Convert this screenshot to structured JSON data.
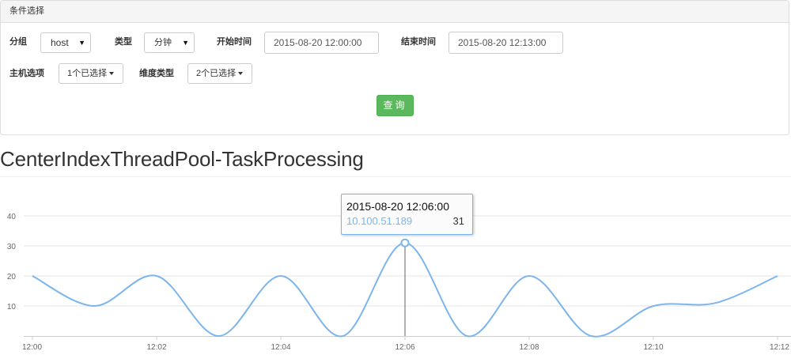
{
  "filter_panel": {
    "title": "条件选择",
    "group_label": "分组",
    "group_value": "host",
    "type_label": "类型",
    "type_value": "分钟",
    "start_label": "开始时间",
    "start_value": "2015-08-20 12:00:00",
    "end_label": "结束时间",
    "end_value": "2015-08-20 12:13:00",
    "host_label": "主机选项",
    "host_value": "1个已选择",
    "dim_label": "维度类型",
    "dim_value": "2个已选择",
    "query_button": "查询"
  },
  "chart_title": "CenterIndexThreadPool-TaskProcessing",
  "tooltip": {
    "time": "2015-08-20 12:06:00",
    "series": "10.100.51.189",
    "value": "31"
  },
  "colors": {
    "series": "#7cb5ec",
    "query_button": "#5cb85c",
    "grid": "#e6e6e6"
  },
  "chart_data": {
    "type": "line",
    "title": "CenterIndexThreadPool-TaskProcessing",
    "x": [
      "12:00",
      "12:01",
      "12:02",
      "12:03",
      "12:04",
      "12:05",
      "12:06",
      "12:07",
      "12:08",
      "12:09",
      "12:10",
      "12:11",
      "12:12"
    ],
    "x_tick_labels": [
      "12:00",
      "12:02",
      "12:04",
      "12:06",
      "12:08",
      "12:10",
      "12:12"
    ],
    "series": [
      {
        "name": "10.100.51.189",
        "values": [
          20,
          10,
          20,
          0,
          20,
          0,
          31,
          0,
          20,
          0,
          10,
          11,
          20
        ]
      }
    ],
    "y_ticks": [
      10,
      20,
      30,
      40
    ],
    "ylim": [
      0,
      45
    ],
    "grid": true,
    "highlight": {
      "x": "12:06",
      "value": 31
    }
  }
}
